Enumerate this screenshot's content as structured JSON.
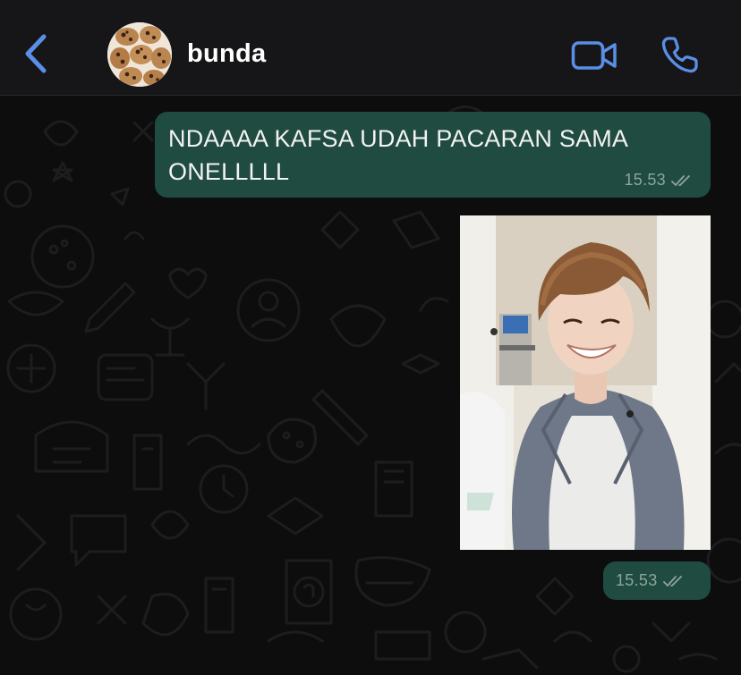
{
  "header": {
    "contact_name": "bunda",
    "back_icon": "chevron-left-icon",
    "video_icon": "video-call-icon",
    "call_icon": "phone-icon",
    "accent_color": "#5b8ee6"
  },
  "messages": [
    {
      "type": "text",
      "text": "NDAAAA KAFSA UDAH PACARAN SAMA ONELLLLL",
      "time": "15.53",
      "status_icon": "double-check-icon",
      "bubble_color": "#1f4b40"
    },
    {
      "type": "image",
      "time": "15.53",
      "status_icon": "double-check-icon",
      "bubble_color": "#1f4b40"
    }
  ]
}
